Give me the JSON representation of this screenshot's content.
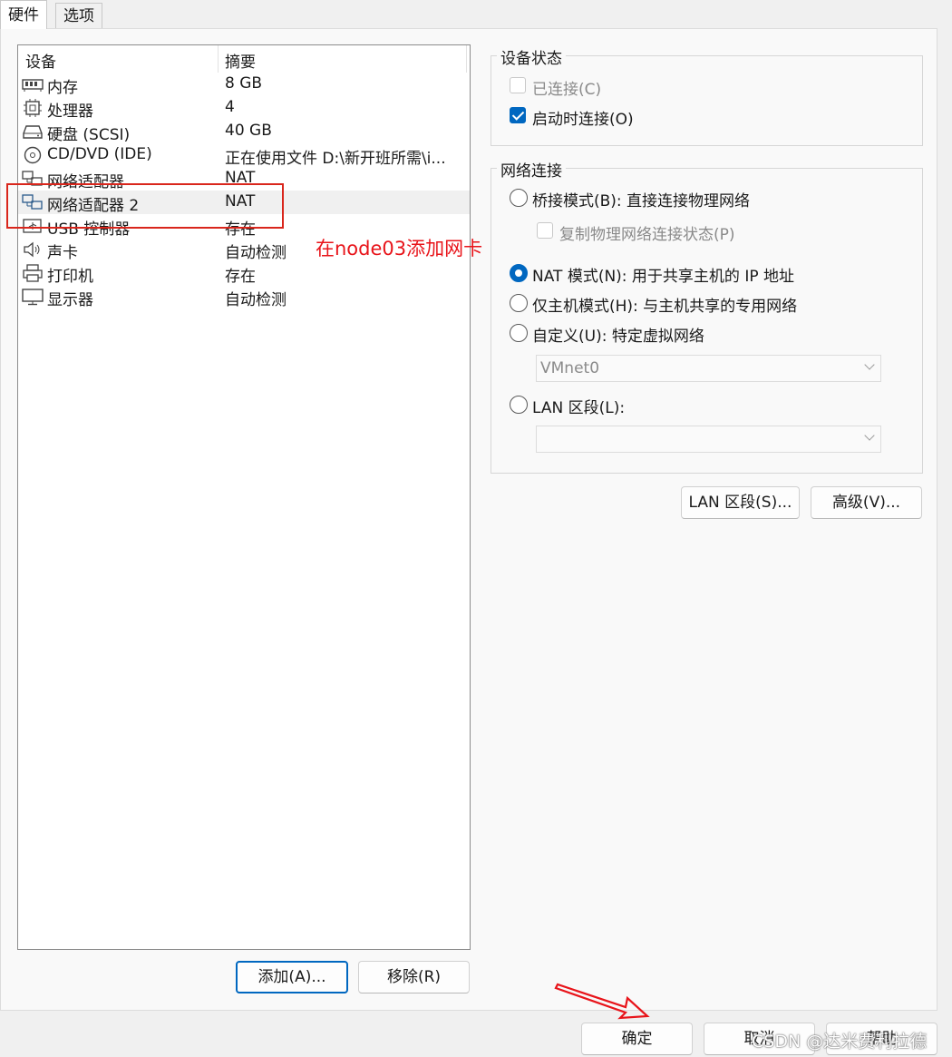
{
  "tabs": [
    {
      "label": "硬件"
    },
    {
      "label": "选项"
    }
  ],
  "device_list": {
    "headers": {
      "device": "设备",
      "summary": "摘要"
    },
    "rows": [
      {
        "icon": "memory-icon",
        "name": "内存",
        "summary": "8 GB"
      },
      {
        "icon": "processor-icon",
        "name": "处理器",
        "summary": "4"
      },
      {
        "icon": "hard-disk-icon",
        "name": "硬盘 (SCSI)",
        "summary": "40 GB"
      },
      {
        "icon": "cd-dvd-icon",
        "name": "CD/DVD (IDE)",
        "summary": "正在使用文件 D:\\新开班所需\\i..."
      },
      {
        "icon": "network-adapter-icon",
        "name": "网络适配器",
        "summary": "NAT"
      },
      {
        "icon": "network-adapter-icon",
        "name": "网络适配器 2",
        "summary": "NAT",
        "selected": true
      },
      {
        "icon": "usb-controller-icon",
        "name": "USB 控制器",
        "summary": "存在"
      },
      {
        "icon": "sound-card-icon",
        "name": "声卡",
        "summary": "自动检测"
      },
      {
        "icon": "printer-icon",
        "name": "打印机",
        "summary": "存在"
      },
      {
        "icon": "display-icon",
        "name": "显示器",
        "summary": "自动检测"
      }
    ]
  },
  "device_status": {
    "title": "设备状态",
    "connected": {
      "label": "已连接(C)",
      "checked": false,
      "disabled": true
    },
    "connect_at_power_on": {
      "label": "启动时连接(O)",
      "checked": true
    }
  },
  "network_connection": {
    "title": "网络连接",
    "bridged": {
      "label": "桥接模式(B): 直接连接物理网络",
      "selected": false
    },
    "replicate": {
      "label": "复制物理网络连接状态(P)",
      "checked": false,
      "disabled": true
    },
    "nat": {
      "label": "NAT 模式(N): 用于共享主机的 IP 地址",
      "selected": true
    },
    "host_only": {
      "label": "仅主机模式(H): 与主机共享的专用网络",
      "selected": false
    },
    "custom": {
      "label": "自定义(U): 特定虚拟网络",
      "selected": false
    },
    "custom_select": "VMnet0",
    "lan_segment": {
      "label": "LAN 区段(L):",
      "selected": false
    },
    "lan_select": ""
  },
  "buttons": {
    "lan_segments": "LAN 区段(S)...",
    "advanced": "高级(V)...",
    "add": "添加(A)...",
    "remove": "移除(R)",
    "ok": "确定",
    "cancel": "取消",
    "help": "帮助"
  },
  "annotation": {
    "text": "在node03添加网卡"
  },
  "watermark": "CSDN @达米费利拉德",
  "colors": {
    "accent": "#0067c0",
    "annotation": "#e8141a"
  }
}
